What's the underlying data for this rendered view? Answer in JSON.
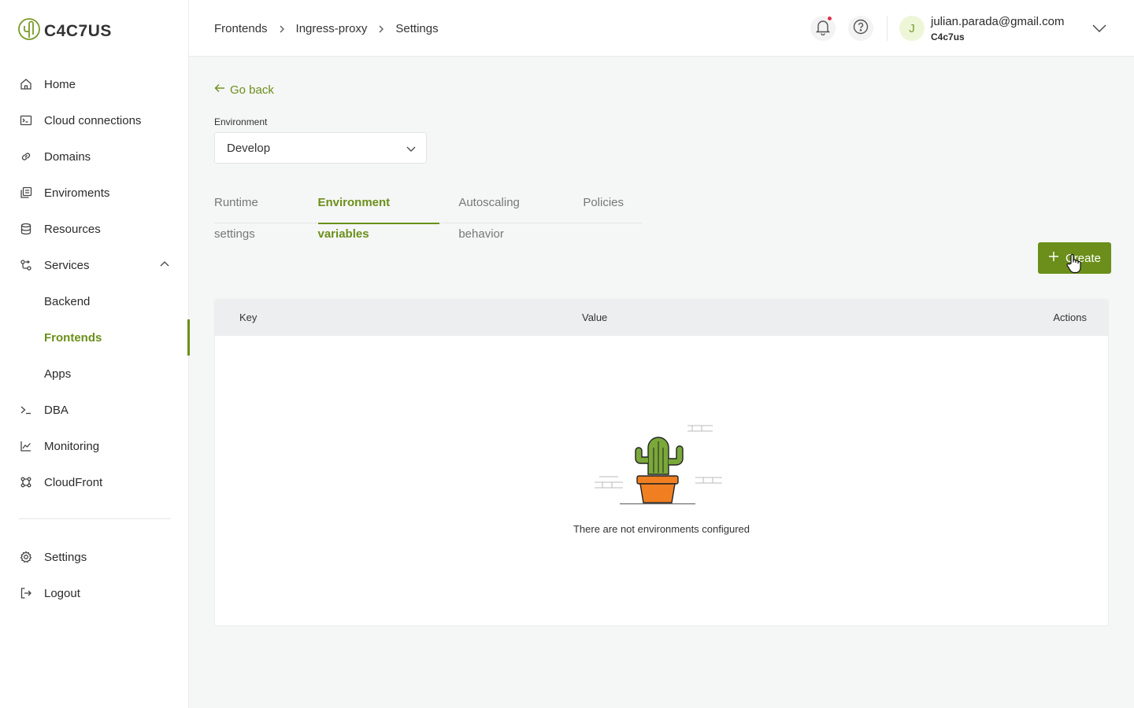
{
  "brand": {
    "name": "C4C7US"
  },
  "sidebar": {
    "items": [
      {
        "label": "Home",
        "icon": "home-icon"
      },
      {
        "label": "Cloud connections",
        "icon": "terminal-box-icon"
      },
      {
        "label": "Domains",
        "icon": "link-icon"
      },
      {
        "label": "Enviroments",
        "icon": "environments-icon"
      },
      {
        "label": "Resources",
        "icon": "database-icon"
      },
      {
        "label": "Services",
        "icon": "services-icon",
        "expanded": true
      },
      {
        "label": "Backend"
      },
      {
        "label": "Frontends",
        "active": true
      },
      {
        "label": "Apps"
      },
      {
        "label": "DBA",
        "icon": "prompt-icon"
      },
      {
        "label": "Monitoring",
        "icon": "chart-line-icon"
      },
      {
        "label": "CloudFront",
        "icon": "cloudfront-icon"
      }
    ],
    "bottom": [
      {
        "label": "Settings",
        "icon": "gear-icon"
      },
      {
        "label": "Logout",
        "icon": "logout-icon"
      }
    ]
  },
  "header": {
    "breadcrumb": [
      "Frontends",
      "Ingress-proxy",
      "Settings"
    ],
    "user": {
      "initial": "J",
      "email": "julian.parada@gmail.com",
      "org": "C4c7us"
    }
  },
  "main": {
    "go_back": "Go back",
    "environment": {
      "label": "Environment",
      "value": "Develop"
    },
    "tabs": [
      "Runtime settings",
      "Environment variables",
      "Autoscaling behavior",
      "Policies"
    ],
    "active_tab": "Environment variables",
    "create_label": "Create",
    "table": {
      "columns": [
        "Key",
        "Value",
        "Actions"
      ],
      "rows": [],
      "empty_text": "There are not environments configured"
    }
  },
  "colors": {
    "accent": "#6b8f1a",
    "notification": "#e0304a",
    "cactus_green": "#7aa83a",
    "pot_orange": "#f07f22"
  }
}
